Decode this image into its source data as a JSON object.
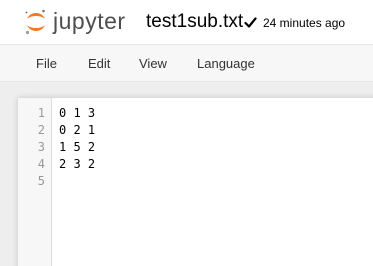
{
  "header": {
    "logo_text": "jupyter",
    "filename": "test1sub.txt",
    "last_modified": "24 minutes ago",
    "logo_color": "#f37726"
  },
  "menu": {
    "items": [
      "File",
      "Edit",
      "View",
      "Language"
    ]
  },
  "editor": {
    "line_numbers": [
      "1",
      "2",
      "3",
      "4",
      "5"
    ],
    "lines": [
      "0 1 3",
      "0 2 1",
      "1 5 2",
      "2 3 2",
      ""
    ]
  }
}
